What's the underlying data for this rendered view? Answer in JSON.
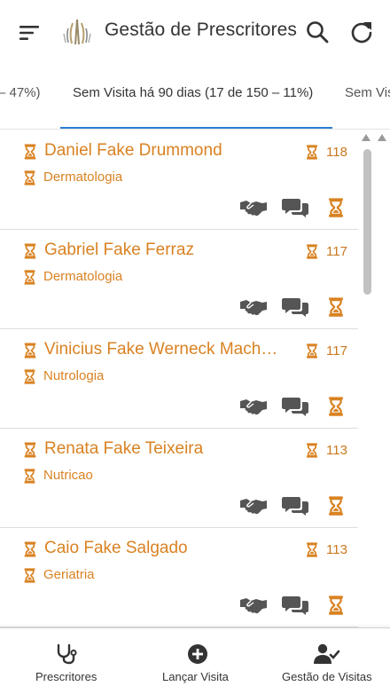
{
  "header": {
    "title": "Gestão de Prescritores",
    "menu_icon": "menu-icon",
    "logo": "app-logo",
    "search_icon": "search-icon",
    "refresh_icon": "refresh-icon"
  },
  "tabs": {
    "prev": "– 47%)",
    "active": "Sem Visita há 90 dias (17 de 150 – 11%)",
    "next": "Sem Vis"
  },
  "colors": {
    "accent": "#d98222",
    "tab_indicator": "#2d7fd6",
    "action_icons": "#555555"
  },
  "prescribers": [
    {
      "name": "Daniel Fake Drummond",
      "specialty": "Dermatologia",
      "days": "118"
    },
    {
      "name": "Gabriel Fake Ferraz",
      "specialty": "Dermatologia",
      "days": "117"
    },
    {
      "name": "Vinicius Fake Werneck Mach…",
      "specialty": "Nutrologia",
      "days": "117"
    },
    {
      "name": "Renata Fake Teixeira",
      "specialty": "Nutricao",
      "days": "113"
    },
    {
      "name": "Caio Fake Salgado",
      "specialty": "Geriatria",
      "days": "113"
    }
  ],
  "bottom_nav": {
    "prescribers": "Prescritores",
    "launch_visit": "Lançar Visita",
    "visit_management": "Gestão de Visitas"
  }
}
